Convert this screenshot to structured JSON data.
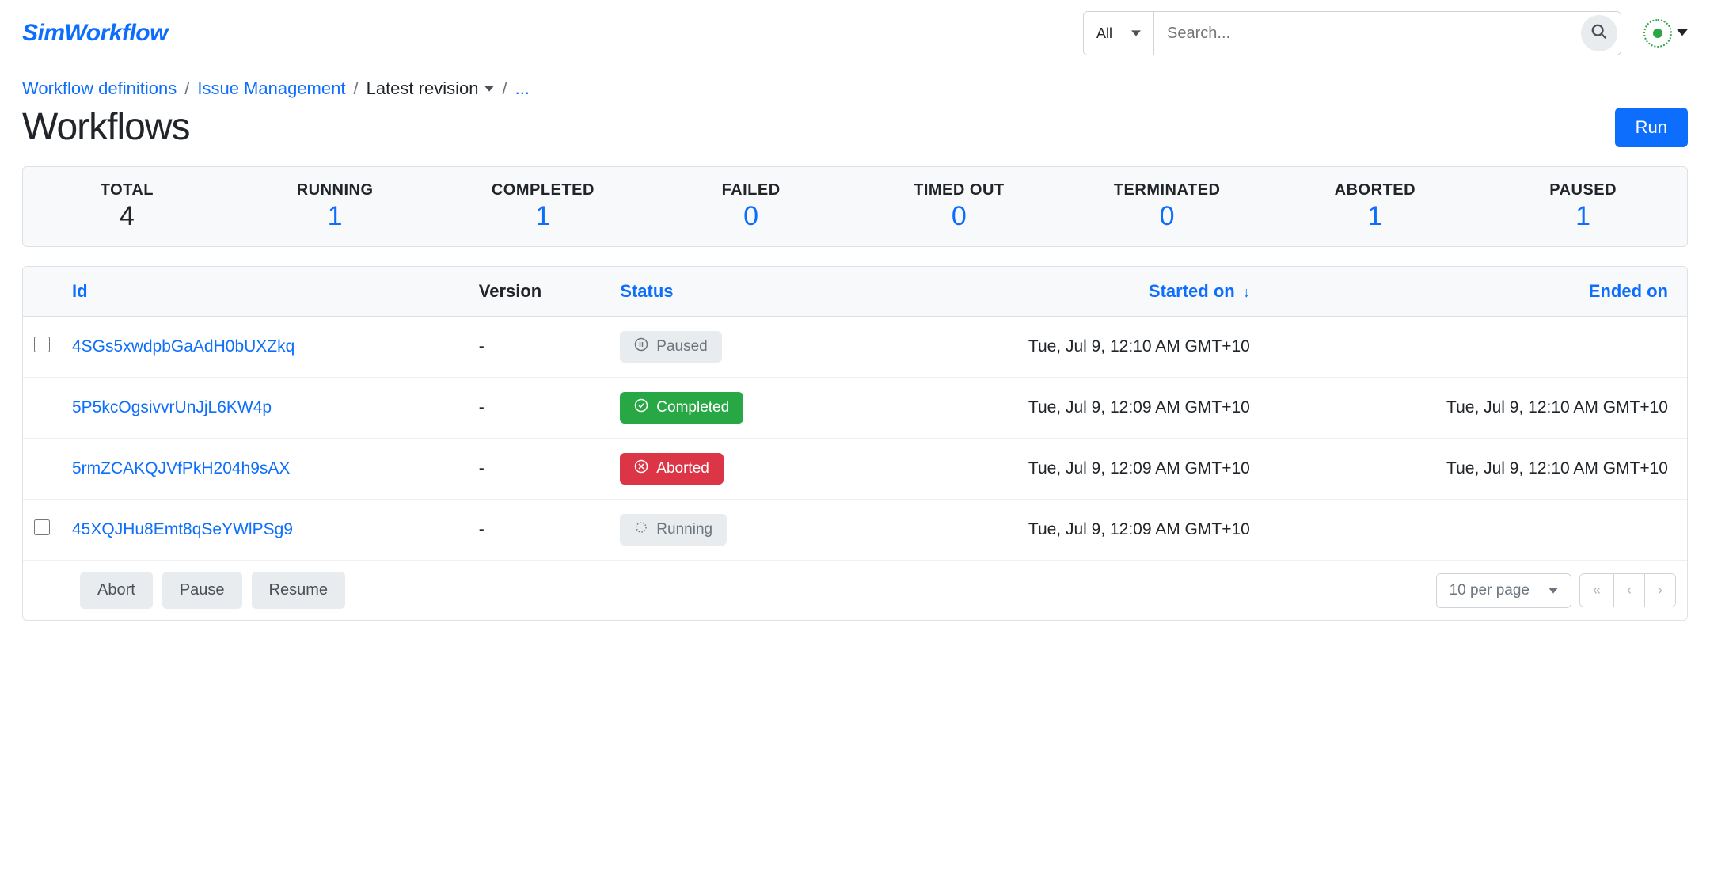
{
  "brand": "SimWorkflow",
  "search": {
    "filter_label": "All",
    "placeholder": "Search..."
  },
  "breadcrumb": {
    "definitions": "Workflow definitions",
    "project": "Issue Management",
    "revision": "Latest revision",
    "more": "..."
  },
  "page_title": "Workflows",
  "run_button": "Run",
  "stats": [
    {
      "label": "TOTAL",
      "value": "4",
      "blue": false
    },
    {
      "label": "RUNNING",
      "value": "1",
      "blue": true
    },
    {
      "label": "COMPLETED",
      "value": "1",
      "blue": true
    },
    {
      "label": "FAILED",
      "value": "0",
      "blue": true
    },
    {
      "label": "TIMED OUT",
      "value": "0",
      "blue": true
    },
    {
      "label": "TERMINATED",
      "value": "0",
      "blue": true
    },
    {
      "label": "ABORTED",
      "value": "1",
      "blue": true
    },
    {
      "label": "PAUSED",
      "value": "1",
      "blue": true
    }
  ],
  "columns": {
    "id": "Id",
    "version": "Version",
    "status": "Status",
    "started": "Started on",
    "ended": "Ended on"
  },
  "rows": [
    {
      "checkbox": true,
      "id": "4SGs5xwdpbGaAdH0bUXZkq",
      "version": "-",
      "status": "Paused",
      "status_kind": "paused",
      "started": "Tue, Jul 9, 12:10 AM GMT+10",
      "ended": ""
    },
    {
      "checkbox": false,
      "id": "5P5kcOgsivvrUnJjL6KW4p",
      "version": "-",
      "status": "Completed",
      "status_kind": "completed",
      "started": "Tue, Jul 9, 12:09 AM GMT+10",
      "ended": "Tue, Jul 9, 12:10 AM GMT+10"
    },
    {
      "checkbox": false,
      "id": "5rmZCAKQJVfPkH204h9sAX",
      "version": "-",
      "status": "Aborted",
      "status_kind": "aborted",
      "started": "Tue, Jul 9, 12:09 AM GMT+10",
      "ended": "Tue, Jul 9, 12:10 AM GMT+10"
    },
    {
      "checkbox": true,
      "id": "45XQJHu8Emt8qSeYWlPSg9",
      "version": "-",
      "status": "Running",
      "status_kind": "running",
      "started": "Tue, Jul 9, 12:09 AM GMT+10",
      "ended": ""
    }
  ],
  "actions": {
    "abort": "Abort",
    "pause": "Pause",
    "resume": "Resume"
  },
  "pagination": {
    "per_page_label": "10 per page"
  }
}
